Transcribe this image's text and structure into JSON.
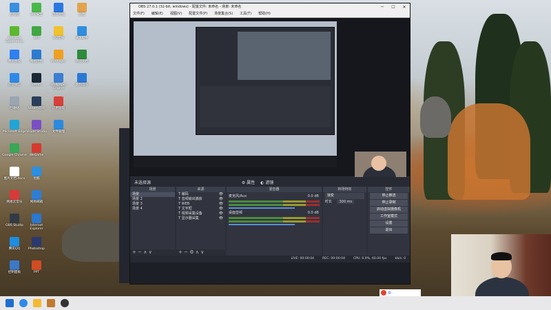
{
  "desktop": {
    "icons": [
      {
        "label": "此电脑",
        "color": "#3b8fe0"
      },
      {
        "label": "GeForce Experience",
        "color": "#5cb82e"
      },
      {
        "label": "腾讯会议",
        "color": "#2f7ff0"
      },
      {
        "label": "企业微信",
        "color": "#2f89e8"
      },
      {
        "label": "回收站",
        "color": "#9aa6b2"
      },
      {
        "label": "Microsoft Edge",
        "color": "#1fa5d6"
      },
      {
        "label": "Google Chrome",
        "color": "#3aa757"
      },
      {
        "label": "图片文档.docx",
        "color": "#ffffff"
      },
      {
        "label": "网易云音乐",
        "color": "#d83a3a"
      },
      {
        "label": "OBS Studio",
        "color": "#333a45"
      },
      {
        "label": "腾讯QQ",
        "color": "#1d8de0"
      },
      {
        "label": "控制面板",
        "color": "#3d78c7"
      },
      {
        "label": "360安全",
        "color": "#49b84a"
      },
      {
        "label": "360",
        "color": "#40a840"
      },
      {
        "label": "网络连接",
        "color": "#2d7bd0"
      },
      {
        "label": "Steam",
        "color": "#1b2838"
      },
      {
        "label": "Steam游戏",
        "color": "#2a3e5a"
      },
      {
        "label": "Visual Studio",
        "color": "#7b4fc4"
      },
      {
        "label": "WeGame",
        "color": "#d43b30"
      },
      {
        "label": "优酷",
        "color": "#2b8fe0"
      },
      {
        "label": "网易邮箱",
        "color": "#2c7ed4"
      },
      {
        "label": "Internet Explorer",
        "color": "#2a78d0"
      },
      {
        "label": "Photoshop",
        "color": "#2a3a6e"
      },
      {
        "label": "PPT",
        "color": "#d14d24"
      },
      {
        "label": "百度网盘",
        "color": "#2a78e0"
      },
      {
        "label": "QQ音乐",
        "color": "#f2c12e"
      },
      {
        "label": "PotPlayer",
        "color": "#f0a020"
      },
      {
        "label": "Wallpaper Engine",
        "color": "#3c7ed0"
      },
      {
        "label": "应用管理",
        "color": "#d8403a"
      },
      {
        "label": "文件管理",
        "color": "#2a8ae0"
      },
      {
        "label": "画图",
        "color": "#e3a24d"
      },
      {
        "label": "录屏助手",
        "color": "#2f8ee0"
      },
      {
        "label": "新建文档",
        "color": "#2e8a3c"
      },
      {
        "label": "酷狗音乐",
        "color": "#2a77d6"
      }
    ]
  },
  "obs": {
    "title": "OBS 27.0.1 (32-bit, windows) - 配置文件: 未命名 - 场景: 未命名",
    "menu": [
      "文件(F)",
      "编辑(E)",
      "视图(V)",
      "配置文件(P)",
      "场景集合(S)",
      "工具(T)",
      "帮助(H)"
    ],
    "scenebar_left": "未选择源",
    "scenebar_props": "属性",
    "scenebar_filters": "滤镜",
    "docks": {
      "scenes": {
        "title": "场景",
        "items": [
          "场景",
          "场景 2",
          "场景 3",
          "场景 4"
        ],
        "selected": 0
      },
      "sources": {
        "title": "来源",
        "items": [
          "编码",
          "音频输出捕获",
          "WEB",
          "文字框",
          "视频采集设备",
          "显示器采集"
        ]
      },
      "mixer": {
        "title": "混音器",
        "tracks": [
          {
            "name": "麦克风/Aux",
            "db": "0.0 dB"
          },
          {
            "name": "桌面音频",
            "db": "0.0 dB"
          }
        ]
      },
      "transitions": {
        "title": "转场特效",
        "type": "渐变",
        "duration_label": "时长",
        "duration": "300 ms"
      },
      "controls": {
        "title": "控件",
        "buttons": [
          "停止推流",
          "停止录制",
          "启动虚拟摄像机",
          "工作室模式",
          "设置",
          "退出"
        ]
      }
    },
    "status": {
      "live": "LIVE: 00:00:04",
      "rec": "REC: 00:00:04",
      "cpu": "CPU: 0.9%, 60.00 fps",
      "kbps": "kb/s: 0"
    },
    "ctrl_icons": {
      "add": "+",
      "remove": "−",
      "up": "∧",
      "down": "∨"
    }
  },
  "taskbar": {
    "ime": "中 ·"
  }
}
